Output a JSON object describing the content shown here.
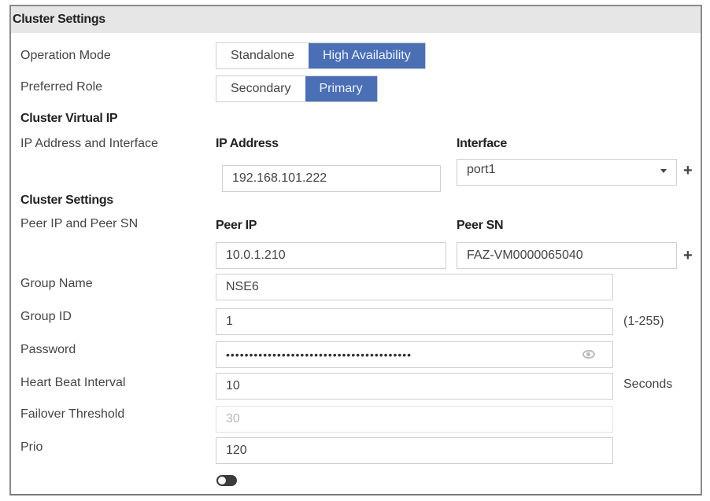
{
  "header": {
    "title": "Cluster Settings"
  },
  "operation_mode": {
    "label": "Operation Mode",
    "options": [
      "Standalone",
      "High Availability"
    ],
    "selected": "High Availability"
  },
  "preferred_role": {
    "label": "Preferred Role",
    "options": [
      "Secondary",
      "Primary"
    ],
    "selected": "Primary"
  },
  "cluster_virtual_ip": {
    "section_title": "Cluster Virtual IP",
    "label": "IP Address and Interface",
    "ip_header": "IP Address",
    "interface_header": "Interface",
    "ip_value": "192.168.101.222",
    "interface_value": "port1",
    "add_icon": "+"
  },
  "cluster_settings": {
    "section_title": "Cluster Settings",
    "peer_label": "Peer IP and Peer SN",
    "peer_ip_header": "Peer IP",
    "peer_sn_header": "Peer SN",
    "peer_ip_value": "10.0.1.210",
    "peer_sn_value": "FAZ-VM0000065040",
    "add_icon": "+"
  },
  "fields": {
    "group_name": {
      "label": "Group Name",
      "value": "NSE6"
    },
    "group_id": {
      "label": "Group ID",
      "value": "1",
      "hint": "(1-255)"
    },
    "password": {
      "label": "Password",
      "value": "••••••••••••••••••••••••••••••••••••••••"
    },
    "heartbeat": {
      "label": "Heart Beat Interval",
      "value": "10",
      "unit": "Seconds"
    },
    "failover": {
      "label": "Failover Threshold",
      "value": "30"
    },
    "priority": {
      "label": "Prio",
      "value": "120"
    }
  },
  "toggle": {
    "state": "off"
  }
}
